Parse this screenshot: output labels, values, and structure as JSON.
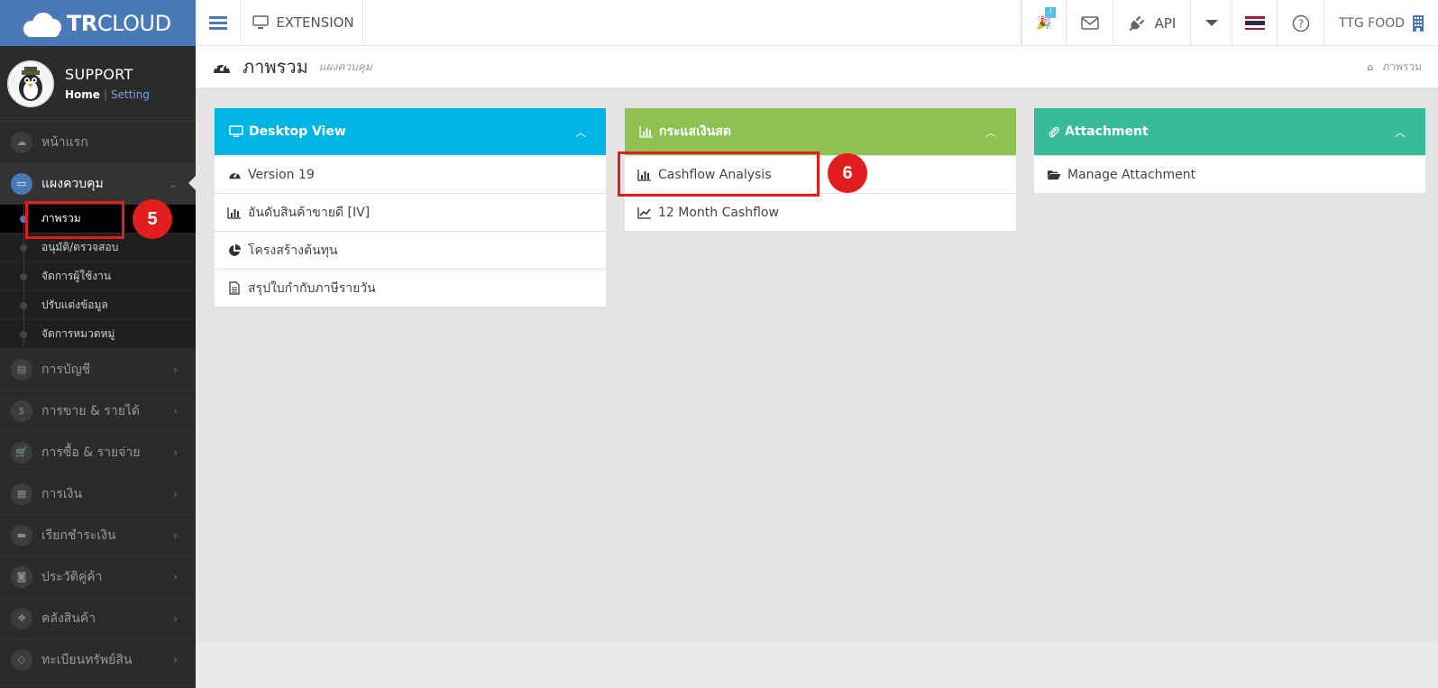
{
  "logo": {
    "brand_bold": "TR",
    "brand_rest": "CLOUD"
  },
  "topbar": {
    "extension_label": "EXTENSION",
    "notification_count": "!",
    "api_label": "API",
    "company": "TTG FOOD"
  },
  "profile": {
    "name": "SUPPORT",
    "home": "Home",
    "separator": "|",
    "setting": "Setting"
  },
  "sidebar": {
    "items": [
      {
        "label": "หน้าแรก"
      },
      {
        "label": "แผงควบคุม"
      },
      {
        "label": "การบัญชี"
      },
      {
        "label": "การขาย & รายได้"
      },
      {
        "label": "การซื้อ & รายจ่าย"
      },
      {
        "label": "การเงิน"
      },
      {
        "label": "เรียกชำระเงิน"
      },
      {
        "label": "ประวัติคู่ค้า"
      },
      {
        "label": "คลังสินค้า"
      },
      {
        "label": "ทะเบียนทรัพย์สิน"
      }
    ],
    "sub_items": [
      {
        "label": "ภาพรวม"
      },
      {
        "label": "อนุมัติ/ตรวจสอบ"
      },
      {
        "label": "จัดการผู้ใช้งาน"
      },
      {
        "label": "ปรับแต่งข้อมูล"
      },
      {
        "label": "จัดการหมวดหมู่"
      }
    ]
  },
  "page": {
    "title": "ภาพรวม",
    "subtitle": "แผงควบคุม",
    "breadcrumb": "ภาพรวม"
  },
  "panels": [
    {
      "title": "Desktop View",
      "color": "#00b4e6",
      "rows": [
        "Version 19",
        "อันดับสินค้าขายดี [IV]",
        "โครงสร้างต้นทุน",
        "สรุปใบกำกับภาษีรายวัน"
      ]
    },
    {
      "title": "กระแสเงินสด",
      "color": "#8dc152",
      "rows": [
        "Cashflow Analysis",
        "12 Month Cashflow"
      ]
    },
    {
      "title": "Attachment",
      "color": "#36bc9b",
      "rows": [
        "Manage Attachment"
      ]
    }
  ],
  "annotations": {
    "step5": "5",
    "step6": "6"
  }
}
